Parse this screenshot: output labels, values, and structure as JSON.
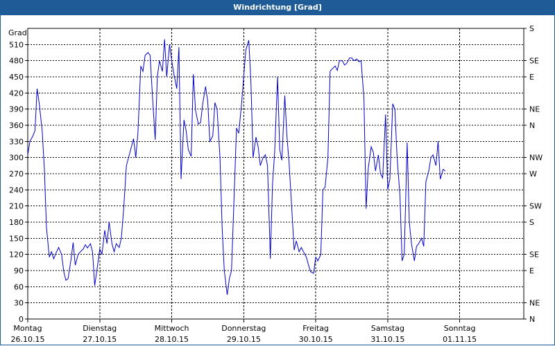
{
  "title": "Windrichtung [Grad]",
  "colors": {
    "titlebar": "#1f5b96",
    "line": "#0000c8",
    "grid": "#000000"
  },
  "chart_data": {
    "type": "line",
    "title": "Windrichtung [Grad]",
    "ylabel": "Grad",
    "ylim": [
      0,
      540
    ],
    "yticks": [
      0,
      30,
      60,
      90,
      120,
      150,
      180,
      210,
      240,
      270,
      300,
      330,
      360,
      390,
      420,
      450,
      480,
      510
    ],
    "right_axis_ticks": [
      {
        "label": "N",
        "value": 0
      },
      {
        "label": "NE",
        "value": 30
      },
      {
        "label": "E",
        "value": 90
      },
      {
        "label": "SE",
        "value": 120
      },
      {
        "label": "S",
        "value": 180
      },
      {
        "label": "SW",
        "value": 210
      },
      {
        "label": "W",
        "value": 270
      },
      {
        "label": "NW",
        "value": 300
      },
      {
        "label": "N",
        "value": 360
      },
      {
        "label": "NE",
        "value": 390
      },
      {
        "label": "E",
        "value": 450
      },
      {
        "label": "SE",
        "value": 480
      },
      {
        "label": "S",
        "value": 540
      }
    ],
    "xlim": [
      0,
      7
    ],
    "x_unit": "days from Montag 26.10.15",
    "xticks": [
      {
        "day": "Montag",
        "date": "26.10.15",
        "x": 0
      },
      {
        "day": "Dienstag",
        "date": "27.10.15",
        "x": 1
      },
      {
        "day": "Mittwoch",
        "date": "28.10.15",
        "x": 2
      },
      {
        "day": "Donnerstag",
        "date": "29.10.15",
        "x": 3
      },
      {
        "day": "Freitag",
        "date": "30.10.15",
        "x": 4
      },
      {
        "day": "Samstag",
        "date": "31.10.15",
        "x": 5
      },
      {
        "day": "Sonntag",
        "date": "01.11.15",
        "x": 6
      }
    ],
    "grid": true,
    "series": [
      {
        "name": "",
        "points": [
          [
            0.0,
            305
          ],
          [
            0.03,
            330
          ],
          [
            0.07,
            340
          ],
          [
            0.1,
            350
          ],
          [
            0.13,
            428
          ],
          [
            0.16,
            400
          ],
          [
            0.2,
            350
          ],
          [
            0.23,
            280
          ],
          [
            0.26,
            170
          ],
          [
            0.3,
            115
          ],
          [
            0.33,
            125
          ],
          [
            0.36,
            112
          ],
          [
            0.4,
            125
          ],
          [
            0.43,
            133
          ],
          [
            0.47,
            120
          ],
          [
            0.5,
            88
          ],
          [
            0.53,
            72
          ],
          [
            0.56,
            75
          ],
          [
            0.6,
            110
          ],
          [
            0.63,
            142
          ],
          [
            0.66,
            100
          ],
          [
            0.7,
            120
          ],
          [
            0.73,
            125
          ],
          [
            0.77,
            130
          ],
          [
            0.8,
            138
          ],
          [
            0.83,
            132
          ],
          [
            0.87,
            140
          ],
          [
            0.9,
            125
          ],
          [
            0.93,
            62
          ],
          [
            0.97,
            100
          ],
          [
            1.0,
            130
          ],
          [
            1.03,
            120
          ],
          [
            1.07,
            165
          ],
          [
            1.1,
            140
          ],
          [
            1.13,
            180
          ],
          [
            1.17,
            140
          ],
          [
            1.2,
            125
          ],
          [
            1.23,
            140
          ],
          [
            1.27,
            133
          ],
          [
            1.3,
            150
          ],
          [
            1.33,
            200
          ],
          [
            1.37,
            285
          ],
          [
            1.4,
            300
          ],
          [
            1.43,
            315
          ],
          [
            1.47,
            335
          ],
          [
            1.5,
            300
          ],
          [
            1.53,
            345
          ],
          [
            1.57,
            470
          ],
          [
            1.6,
            460
          ],
          [
            1.63,
            490
          ],
          [
            1.67,
            495
          ],
          [
            1.7,
            490
          ],
          [
            1.73,
            420
          ],
          [
            1.77,
            333
          ],
          [
            1.8,
            450
          ],
          [
            1.83,
            480
          ],
          [
            1.87,
            460
          ],
          [
            1.9,
            520
          ],
          [
            1.93,
            450
          ],
          [
            1.97,
            510
          ],
          [
            2.0,
            480
          ],
          [
            2.03,
            455
          ],
          [
            2.07,
            428
          ],
          [
            2.1,
            505
          ],
          [
            2.13,
            260
          ],
          [
            2.17,
            370
          ],
          [
            2.2,
            350
          ],
          [
            2.23,
            315
          ],
          [
            2.27,
            302
          ],
          [
            2.3,
            455
          ],
          [
            2.33,
            388
          ],
          [
            2.37,
            362
          ],
          [
            2.4,
            365
          ],
          [
            2.43,
            400
          ],
          [
            2.47,
            432
          ],
          [
            2.5,
            405
          ],
          [
            2.53,
            330
          ],
          [
            2.57,
            340
          ],
          [
            2.6,
            402
          ],
          [
            2.63,
            390
          ],
          [
            2.67,
            300
          ],
          [
            2.7,
            170
          ],
          [
            2.73,
            90
          ],
          [
            2.77,
            45
          ],
          [
            2.8,
            75
          ],
          [
            2.83,
            90
          ],
          [
            2.87,
            240
          ],
          [
            2.9,
            355
          ],
          [
            2.93,
            345
          ],
          [
            2.97,
            400
          ],
          [
            3.0,
            450
          ],
          [
            3.03,
            500
          ],
          [
            3.07,
            518
          ],
          [
            3.1,
            440
          ],
          [
            3.13,
            300
          ],
          [
            3.17,
            338
          ],
          [
            3.2,
            320
          ],
          [
            3.23,
            285
          ],
          [
            3.27,
            300
          ],
          [
            3.3,
            305
          ],
          [
            3.33,
            285
          ],
          [
            3.37,
            112
          ],
          [
            3.4,
            250
          ],
          [
            3.43,
            310
          ],
          [
            3.47,
            450
          ],
          [
            3.5,
            315
          ],
          [
            3.53,
            295
          ],
          [
            3.57,
            415
          ],
          [
            3.6,
            340
          ],
          [
            3.63,
            290
          ],
          [
            3.67,
            200
          ],
          [
            3.7,
            128
          ],
          [
            3.73,
            145
          ],
          [
            3.77,
            125
          ],
          [
            3.8,
            133
          ],
          [
            3.83,
            125
          ],
          [
            3.87,
            115
          ],
          [
            3.9,
            100
          ],
          [
            3.93,
            88
          ],
          [
            3.97,
            85
          ],
          [
            4.0,
            115
          ],
          [
            4.03,
            108
          ],
          [
            4.07,
            120
          ],
          [
            4.1,
            240
          ],
          [
            4.13,
            245
          ],
          [
            4.17,
            300
          ],
          [
            4.2,
            460
          ],
          [
            4.23,
            465
          ],
          [
            4.27,
            470
          ],
          [
            4.3,
            462
          ],
          [
            4.33,
            480
          ],
          [
            4.37,
            480
          ],
          [
            4.4,
            472
          ],
          [
            4.43,
            475
          ],
          [
            4.47,
            485
          ],
          [
            4.5,
            485
          ],
          [
            4.53,
            480
          ],
          [
            4.57,
            483
          ],
          [
            4.6,
            478
          ],
          [
            4.63,
            480
          ],
          [
            4.67,
            410
          ],
          [
            4.7,
            205
          ],
          [
            4.73,
            280
          ],
          [
            4.77,
            320
          ],
          [
            4.8,
            310
          ],
          [
            4.83,
            275
          ],
          [
            4.87,
            305
          ],
          [
            4.9,
            270
          ],
          [
            4.93,
            262
          ],
          [
            4.97,
            380
          ],
          [
            5.0,
            240
          ],
          [
            5.03,
            260
          ],
          [
            5.07,
            400
          ],
          [
            5.1,
            390
          ],
          [
            5.13,
            300
          ],
          [
            5.17,
            230
          ],
          [
            5.2,
            108
          ],
          [
            5.23,
            120
          ],
          [
            5.27,
            328
          ],
          [
            5.3,
            180
          ],
          [
            5.33,
            140
          ],
          [
            5.37,
            108
          ],
          [
            5.4,
            135
          ],
          [
            5.43,
            140
          ],
          [
            5.47,
            150
          ],
          [
            5.5,
            135
          ],
          [
            5.53,
            255
          ],
          [
            5.57,
            275
          ],
          [
            5.6,
            300
          ],
          [
            5.63,
            305
          ],
          [
            5.67,
            285
          ],
          [
            5.7,
            330
          ],
          [
            5.73,
            260
          ],
          [
            5.77,
            278
          ],
          [
            5.8,
            275
          ]
        ]
      }
    ]
  }
}
